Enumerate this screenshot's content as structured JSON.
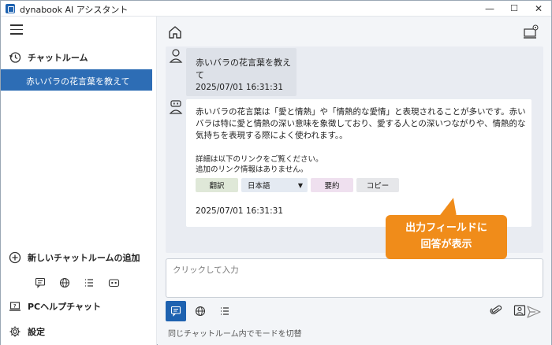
{
  "app": {
    "title": "dynabook AI アシスタント"
  },
  "window_controls": {
    "minimize": "—",
    "maximize": "☐",
    "close": "✕"
  },
  "sidebar": {
    "section_title": "チャットルーム",
    "active_item": "赤いバラの花言葉を教えて",
    "add_room": "新しいチャットルームの追加",
    "pc_help": "PCヘルプチャット",
    "settings": "設定"
  },
  "chat": {
    "user_message": "赤いバラの花言葉を教えて",
    "user_timestamp": "2025/07/01 16:31:31",
    "bot_answer": "赤いバラの花言葉は「愛と情熱」や「情熱的な愛情」と表現されることが多いです。赤いバラは特に愛と情熱の深い意味を象徴しており、愛する人との深いつながりや、情熱的な気持ちを表現する際によく使われます。。",
    "bot_detail_line1": "詳細は以下のリンクをご覧ください。",
    "bot_detail_line2": "追加のリンク情報はありません。",
    "actions": {
      "translate": "翻訳",
      "language": "日本語",
      "summary": "要約",
      "copy": "コピー"
    },
    "bot_timestamp": "2025/07/01 16:31:31"
  },
  "callout": {
    "line1": "出力フィールドに",
    "line2": "回答が表示"
  },
  "input": {
    "placeholder": "クリックして入力"
  },
  "hint": "同じチャットルーム内でモードを切替",
  "colors": {
    "accent": "#1e62b0",
    "callout": "#f08c1a",
    "active_item": "#2d6db5"
  }
}
